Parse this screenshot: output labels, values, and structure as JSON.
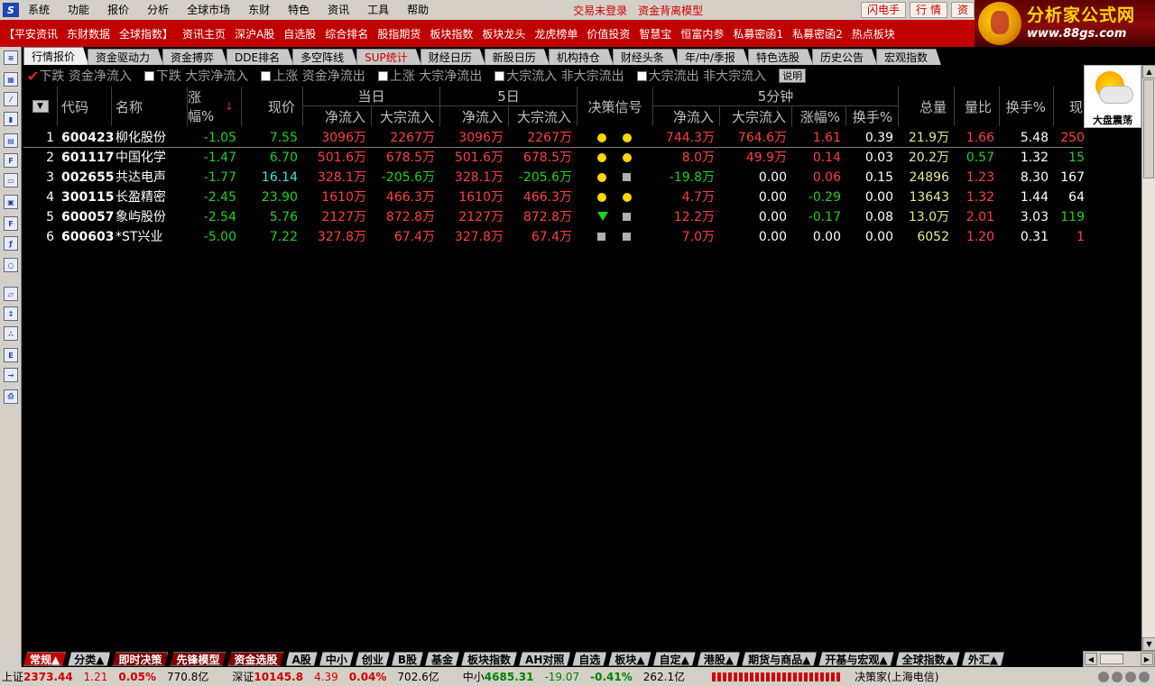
{
  "menu": {
    "items": [
      "系统",
      "功能",
      "报价",
      "分析",
      "全球市场",
      "东财",
      "特色",
      "资讯",
      "工具",
      "帮助"
    ],
    "red_links": [
      "交易未登录",
      "资金背离模型"
    ],
    "buttons": [
      "闪电手",
      "行 情",
      "资"
    ]
  },
  "logo": {
    "title": "分析家公式网",
    "url": "www.88gs.com"
  },
  "linkbar": {
    "items": [
      "【平安资讯",
      "东财数据",
      "全球指数】",
      "资讯主页",
      "深沪A股",
      "自选股",
      "综合排名",
      "股指期货",
      "板块指数",
      "板块龙头",
      "龙虎榜单",
      "价值投资",
      "智慧宝",
      "恒富内参",
      "私募密函1",
      "私募密函2",
      "热点板块"
    ]
  },
  "tabs": [
    "行情报价",
    "资金驱动力",
    "资金搏弈",
    "DDE排名",
    "多空阵线",
    "SUP统计",
    "财经日历",
    "新股日历",
    "机构持仓",
    "财经头条",
    "年/中/季报",
    "特色选股",
    "历史公告",
    "宏观指数"
  ],
  "filters": {
    "items": [
      "下跌 资金净流入",
      "下跌 大宗净流入",
      "上涨 资金净流出",
      "上涨 大宗净流出",
      "大宗流入 非大宗流出",
      "大宗流出 非大宗流入"
    ],
    "explain": "说明"
  },
  "weather": {
    "label": "大盘震荡"
  },
  "table": {
    "headers": {
      "code": "代码",
      "name": "名称",
      "change": "涨幅%",
      "price": "现价",
      "today": "当日",
      "five_day": "5日",
      "signal": "决策信号",
      "five_min": "5分钟",
      "net_in": "净流入",
      "block_in": "大宗流入",
      "chg_pct": "涨幅%",
      "turnover": "换手%",
      "volume": "总量",
      "vol_ratio": "量比",
      "turn": "换手%",
      "cur": "现"
    },
    "rows": [
      {
        "idx": "1",
        "code": "600423",
        "name": "柳化股份",
        "chg": "-1.05",
        "price": "7.55",
        "d_net": "3096万",
        "d_blk": "2267万",
        "f_net": "3096万",
        "f_blk": "2267万",
        "sig1": "dot",
        "sig2": "dot",
        "m_net": "744.3万",
        "m_blk": "764.6万",
        "m_chg": "1.61",
        "m_turn": "0.39",
        "vol": "21.9万",
        "ratio": "1.66",
        "turn": "5.48",
        "cur": "250"
      },
      {
        "idx": "2",
        "code": "601117",
        "name": "中国化学",
        "chg": "-1.47",
        "price": "6.70",
        "d_net": "501.6万",
        "d_blk": "678.5万",
        "f_net": "501.6万",
        "f_blk": "678.5万",
        "sig1": "dot",
        "sig2": "dot",
        "m_net": "8.0万",
        "m_blk": "49.9万",
        "m_chg": "0.14",
        "m_turn": "0.03",
        "vol": "20.2万",
        "ratio": "0.57",
        "turn": "1.32",
        "cur": "15"
      },
      {
        "idx": "3",
        "code": "002655",
        "name": "共达电声",
        "chg": "-1.77",
        "price": "16.14",
        "d_net": "328.1万",
        "d_blk": "-205.6万",
        "f_net": "328.1万",
        "f_blk": "-205.6万",
        "sig1": "dot",
        "sig2": "sq",
        "m_net": "-19.8万",
        "m_blk": "0.00",
        "m_chg": "0.06",
        "m_turn": "0.15",
        "vol": "24896",
        "ratio": "1.23",
        "turn": "8.30",
        "cur": "167"
      },
      {
        "idx": "4",
        "code": "300115",
        "name": "长盈精密",
        "chg": "-2.45",
        "price": "23.90",
        "d_net": "1610万",
        "d_blk": "466.3万",
        "f_net": "1610万",
        "f_blk": "466.3万",
        "sig1": "dot",
        "sig2": "dot",
        "m_net": "4.7万",
        "m_blk": "0.00",
        "m_chg": "-0.29",
        "m_turn": "0.00",
        "vol": "13643",
        "ratio": "1.32",
        "turn": "1.44",
        "cur": "64"
      },
      {
        "idx": "5",
        "code": "600057",
        "name": "象屿股份",
        "chg": "-2.54",
        "price": "5.76",
        "d_net": "2127万",
        "d_blk": "872.8万",
        "f_net": "2127万",
        "f_blk": "872.8万",
        "sig1": "tri",
        "sig2": "sq",
        "m_net": "12.2万",
        "m_blk": "0.00",
        "m_chg": "-0.17",
        "m_turn": "0.08",
        "vol": "13.0万",
        "ratio": "2.01",
        "turn": "3.03",
        "cur": "119"
      },
      {
        "idx": "6",
        "code": "600603",
        "name": "*ST兴业",
        "chg": "-5.00",
        "price": "7.22",
        "d_net": "327.8万",
        "d_blk": "67.4万",
        "f_net": "327.8万",
        "f_blk": "67.4万",
        "sig1": "sq",
        "sig2": "sq",
        "m_net": "7.0万",
        "m_blk": "0.00",
        "m_chg": "0.00",
        "m_turn": "0.00",
        "vol": "6052",
        "ratio": "1.20",
        "turn": "0.31",
        "cur": "1"
      }
    ]
  },
  "bottom_tabs": [
    "常规▲",
    "分类▲",
    "即时决策",
    "先锋模型",
    "资金选股",
    "A股",
    "中小",
    "创业",
    "B股",
    "基金",
    "板块指数",
    "AH对照",
    "自选",
    "板块▲",
    "自定▲",
    "港股▲",
    "期货与商品▲",
    "开基与宏观▲",
    "全球指数▲",
    "外汇▲"
  ],
  "status": {
    "sh": {
      "name": "上证",
      "value": "2373.44",
      "chg": "1.21",
      "pct": "0.05%",
      "amt": "770.8亿"
    },
    "sz": {
      "name": "深证",
      "value": "10145.8",
      "chg": "4.39",
      "pct": "0.04%",
      "amt": "702.6亿"
    },
    "zx": {
      "name": "中小",
      "value": "4685.31",
      "chg": "-19.07",
      "pct": "-0.41%",
      "amt": "262.1亿"
    },
    "broker": "决策家(上海电信)"
  }
}
